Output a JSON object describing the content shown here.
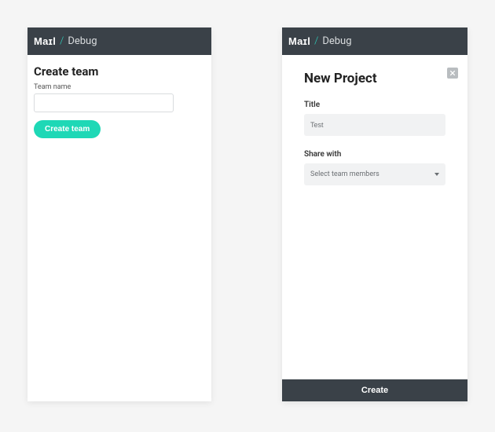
{
  "brand": {
    "name": "Maɪl",
    "sub": "Debug"
  },
  "leftPanel": {
    "title": "Create team",
    "teamNameLabel": "Team name",
    "teamNameValue": "",
    "createButton": "Create team"
  },
  "rightPanel": {
    "title": "New Project",
    "titleLabel": "Title",
    "titleValue": "Test",
    "shareLabel": "Share with",
    "sharePlaceholder": "Select team members",
    "createButton": "Create"
  }
}
